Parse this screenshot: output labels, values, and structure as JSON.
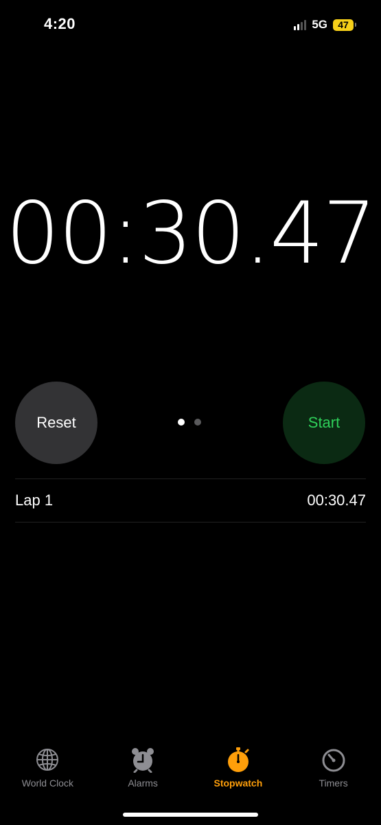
{
  "status_bar": {
    "time": "4:20",
    "network": "5G",
    "battery": "47"
  },
  "stopwatch": {
    "readout": "00:30.47"
  },
  "controls": {
    "reset_label": "Reset",
    "start_label": "Start",
    "page_dots": 2,
    "active_page": 1
  },
  "laps": [
    {
      "label": "Lap 1",
      "time": "00:30.47"
    }
  ],
  "tabs": [
    {
      "label": "World Clock",
      "icon": "globe-icon",
      "active": false
    },
    {
      "label": "Alarms",
      "icon": "alarm-clock-icon",
      "active": false
    },
    {
      "label": "Stopwatch",
      "icon": "stopwatch-icon",
      "active": true
    },
    {
      "label": "Timers",
      "icon": "timer-icon",
      "active": false
    }
  ],
  "colors": {
    "background": "#000000",
    "start_green": "#2fd15a",
    "start_bg": "#0b2a13",
    "reset_bg": "#333335",
    "active_tab": "#ff9f0a",
    "inactive_tab": "#8e8e93",
    "battery": "#f7d019"
  }
}
